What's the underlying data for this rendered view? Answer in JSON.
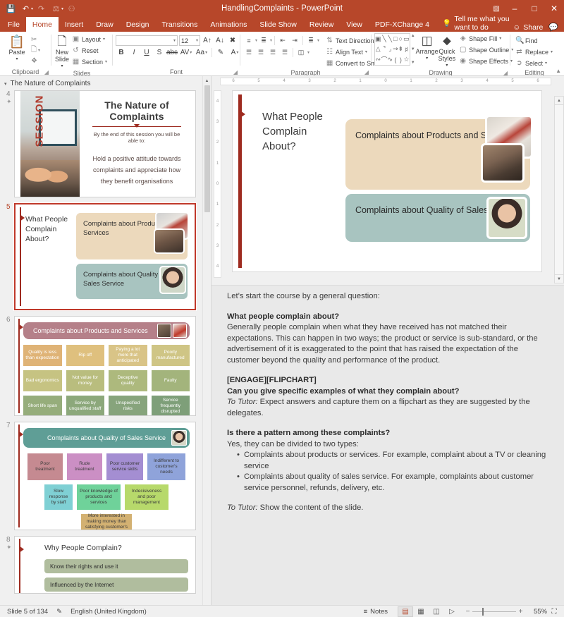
{
  "titlebar": {
    "document_title": "HandlingComplaints  -  PowerPoint",
    "qat": [
      {
        "name": "save-icon",
        "glyph": "💾"
      },
      {
        "name": "undo-icon",
        "glyph": "↶"
      },
      {
        "name": "redo-icon",
        "glyph": "↷"
      },
      {
        "name": "start-slideshow-icon",
        "glyph": "⛶"
      },
      {
        "name": "customize-qat-icon",
        "glyph": "▾"
      }
    ],
    "window": {
      "ribbon_display_options": "☰",
      "minimize": "–",
      "maximize": "□",
      "close": "✕"
    },
    "accent_color": "#b7472a"
  },
  "tabs": [
    {
      "label": "File",
      "active": false
    },
    {
      "label": "Home",
      "active": true
    },
    {
      "label": "Insert",
      "active": false
    },
    {
      "label": "Draw",
      "active": false
    },
    {
      "label": "Design",
      "active": false
    },
    {
      "label": "Transitions",
      "active": false
    },
    {
      "label": "Animations",
      "active": false
    },
    {
      "label": "Slide Show",
      "active": false
    },
    {
      "label": "Review",
      "active": false
    },
    {
      "label": "View",
      "active": false
    },
    {
      "label": "PDF-XChange 4",
      "active": false
    }
  ],
  "tellme": {
    "label": "Tell me what you want to do",
    "icon": "lightbulb-icon"
  },
  "share": {
    "label": "Share",
    "icon": "person-share-icon"
  },
  "comments": {
    "icon": "comment-icon"
  },
  "ribbon": {
    "groups": [
      {
        "name": "Clipboard",
        "label": "Clipboard",
        "big": {
          "label": "Paste",
          "icon": "clipboard-icon",
          "has_caret": true
        },
        "small": [
          {
            "label": "",
            "icon": "scissors-icon"
          },
          {
            "label": "",
            "icon": "copy-icon",
            "has_caret": true
          },
          {
            "label": "",
            "icon": "format-painter-icon"
          }
        ]
      },
      {
        "name": "Slides",
        "label": "Slides",
        "big": {
          "label": "New Slide",
          "icon": "new-slide-icon",
          "has_caret": true
        },
        "small": [
          {
            "label": "Layout",
            "icon": "layout-icon",
            "has_caret": true
          },
          {
            "label": "Reset",
            "icon": "reset-icon",
            "has_caret": false
          },
          {
            "label": "Section",
            "icon": "section-icon",
            "has_caret": true
          }
        ]
      },
      {
        "name": "Font",
        "label": "Font",
        "font_name": "",
        "font_size": "12",
        "buttons_row1": [
          "grow-font-icon",
          "shrink-font-icon",
          "clear-formatting-icon"
        ],
        "buttons_row2": [
          "bold-icon",
          "italic-icon",
          "underline-icon",
          "shadow-icon",
          "strikethrough-icon",
          "character-spacing-icon",
          "change-case-icon",
          "text-highlight-icon",
          "font-color-icon"
        ],
        "labels_row2": [
          "B",
          "I",
          "U",
          "S",
          "abc",
          "AV",
          "Aa",
          "✎",
          "A"
        ]
      },
      {
        "name": "Paragraph",
        "label": "Paragraph",
        "small": [
          {
            "label": "Text Direction",
            "icon": "text-direction-icon",
            "has_caret": true
          },
          {
            "label": "Align Text",
            "icon": "align-text-icon",
            "has_caret": true
          },
          {
            "label": "Convert to SmartArt",
            "icon": "smartart-icon",
            "has_caret": true
          }
        ]
      },
      {
        "name": "Drawing",
        "label": "Drawing",
        "shapes_gallery": [
          "▭",
          "╲",
          "╲",
          "□",
          "○",
          "▭",
          "△",
          "┐",
          "┗",
          "⇨",
          "⇩",
          "◗",
          "⤳",
          "⌒",
          "∿",
          "(",
          ")",
          "☆"
        ],
        "arrange": {
          "label": "Arrange",
          "icon": "arrange-icon",
          "has_caret": true
        },
        "quick_styles": {
          "label": "Quick Styles",
          "icon": "quick-styles-icon",
          "has_caret": true
        },
        "small": [
          {
            "label": "Shape Fill",
            "icon": "shape-fill-icon",
            "has_caret": true
          },
          {
            "label": "Shape Outline",
            "icon": "shape-outline-icon",
            "has_caret": true
          },
          {
            "label": "Shape Effects",
            "icon": "shape-effects-icon",
            "has_caret": true
          }
        ]
      },
      {
        "name": "Editing",
        "label": "Editing",
        "small": [
          {
            "label": "Find",
            "icon": "search-icon",
            "has_caret": false
          },
          {
            "label": "Replace",
            "icon": "replace-icon",
            "has_caret": true
          },
          {
            "label": "Select",
            "icon": "select-icon",
            "has_caret": true
          }
        ],
        "collapse_icon": "chevron-up-icon"
      }
    ]
  },
  "thumbnails": {
    "section_header": "The Nature of Complaints",
    "slides": [
      {
        "number": "4",
        "animated": true,
        "selected": false,
        "title": "The Nature of Complaints",
        "subtitle": "By the end of this session you will be able to:",
        "body": "Hold a positive attitude towards complaints and appreciate how they benefit organisations",
        "side_word": "SESSION"
      },
      {
        "number": "5",
        "animated": false,
        "selected": true,
        "title": "What People Complain About?",
        "cards": [
          {
            "text": "Complaints about Products and Services",
            "color": "#ecd9bc"
          },
          {
            "text": "Complaints about Quality of Sales Service",
            "color": "#a8c4c0"
          }
        ]
      },
      {
        "number": "6",
        "animated": false,
        "selected": false,
        "banner": "Complaints about Products and Services",
        "banner_color": "#b58089",
        "cells": [
          {
            "text": "Quality is less than expectation",
            "color": "#dfb376"
          },
          {
            "text": "Rip off",
            "color": "#dfc07e"
          },
          {
            "text": "Paying a lot more that anticipated",
            "color": "#d9c487"
          },
          {
            "text": "Poorly manufactured",
            "color": "#cfc585"
          },
          {
            "text": "Bad ergonomics",
            "color": "#c6c382"
          },
          {
            "text": "Not value for money",
            "color": "#b9bd7e"
          },
          {
            "text": "Deceptive quality",
            "color": "#adb97d"
          },
          {
            "text": "Faulty",
            "color": "#a3b47c"
          },
          {
            "text": "Short life span",
            "color": "#96ad7b"
          },
          {
            "text": "Service by unqualified staff",
            "color": "#8ca87b"
          },
          {
            "text": "Unspecified risks",
            "color": "#87a47c"
          },
          {
            "text": "Service frequently disrupted",
            "color": "#7e9f79"
          }
        ]
      },
      {
        "number": "7",
        "animated": false,
        "selected": false,
        "banner": "Complaints about Quality of Sales Service",
        "banner_color": "#5f9e96",
        "row1": [
          {
            "text": "Poor treatment",
            "color": "#c58a91"
          },
          {
            "text": "Rude treatment",
            "color": "#cb8fc4"
          },
          {
            "text": "Poor customer service skills",
            "color": "#a48ed2"
          },
          {
            "text": "Indifferent to customer's needs",
            "color": "#8fa3da"
          }
        ],
        "row2": [
          {
            "text": "Slow response by staff",
            "color": "#7fd0d4"
          },
          {
            "text": "Poor knowledge of products and services",
            "color": "#6fd29a"
          },
          {
            "text": "Indecisiveness and poor management",
            "color": "#b7d96b"
          }
        ],
        "row3": [
          {
            "text": "More interested in making money than satisfying customer's needs",
            "color": "#d3b172"
          }
        ]
      },
      {
        "number": "8",
        "animated": true,
        "selected": false,
        "title": "Why People Complain?",
        "bars": [
          {
            "text": "Know their rights and use it",
            "color": "#b0bd9e"
          },
          {
            "text": "Influenced by the Internet",
            "color": "#b0bd9e"
          }
        ]
      }
    ]
  },
  "ruler": {
    "horizontal_ticks": [
      "6",
      "5",
      "4",
      "3",
      "2",
      "1",
      "0",
      "1",
      "2",
      "3",
      "4",
      "5",
      "6"
    ],
    "vertical_ticks": [
      "4",
      "3",
      "2",
      "1",
      "0",
      "1",
      "2",
      "3",
      "4"
    ]
  },
  "slide_main": {
    "title": "What People Complain About?",
    "cards": [
      {
        "text": "Complaints about Products and Services",
        "color": "#ecd9bc"
      },
      {
        "text": "Complaints about Quality of Sales Service",
        "color": "#a8c4c0"
      }
    ]
  },
  "notes": {
    "line1": "Let’s start the course by a general question:",
    "h1": "What people complain about?",
    "p1": "Generally people complain when what they have received has not matched their expectations. This can happen in two ways; the product or service is sub-standard, or the advertisement of it is exaggerated to the point that has raised the expectation of the customer beyond the quality and performance of the product.",
    "tag": "[ENGAGE][FLIPCHART]",
    "h2": "Can you give specific examples of what they complain about?",
    "p2_italic": "To Tutor:",
    "p2": " Expect answers and capture them on a flipchart as they are suggested by the delegates.",
    "h3": "Is there a pattern among these complaints?",
    "p3": "Yes, they can be divided to two types:",
    "bullets": [
      "Complaints about products or services. For example, complaint about a TV or cleaning service",
      "Complaints about quality of sales service. For example, complaints about customer service personnel, refunds, delivery, etc."
    ],
    "p4_italic": "To Tutor:",
    "p4": " Show the content of the slide."
  },
  "statusbar": {
    "slide_counter": "Slide 5 of 134",
    "spellcheck_icon": "spellcheck-icon",
    "language": "English (United Kingdom)",
    "notes_label": "Notes",
    "notes_icon": "notes-icon",
    "views": [
      {
        "name": "normal-view",
        "glyph": "▤",
        "active": true
      },
      {
        "name": "slide-sorter-view",
        "glyph": "⌸",
        "active": false
      },
      {
        "name": "reading-view",
        "glyph": "▧",
        "active": false
      },
      {
        "name": "slideshow-view",
        "glyph": "⊟",
        "active": false
      }
    ],
    "zoom_out": "−",
    "zoom_in": "+",
    "zoom_percent": "55%",
    "fit_icon": "fit-to-window-icon"
  }
}
